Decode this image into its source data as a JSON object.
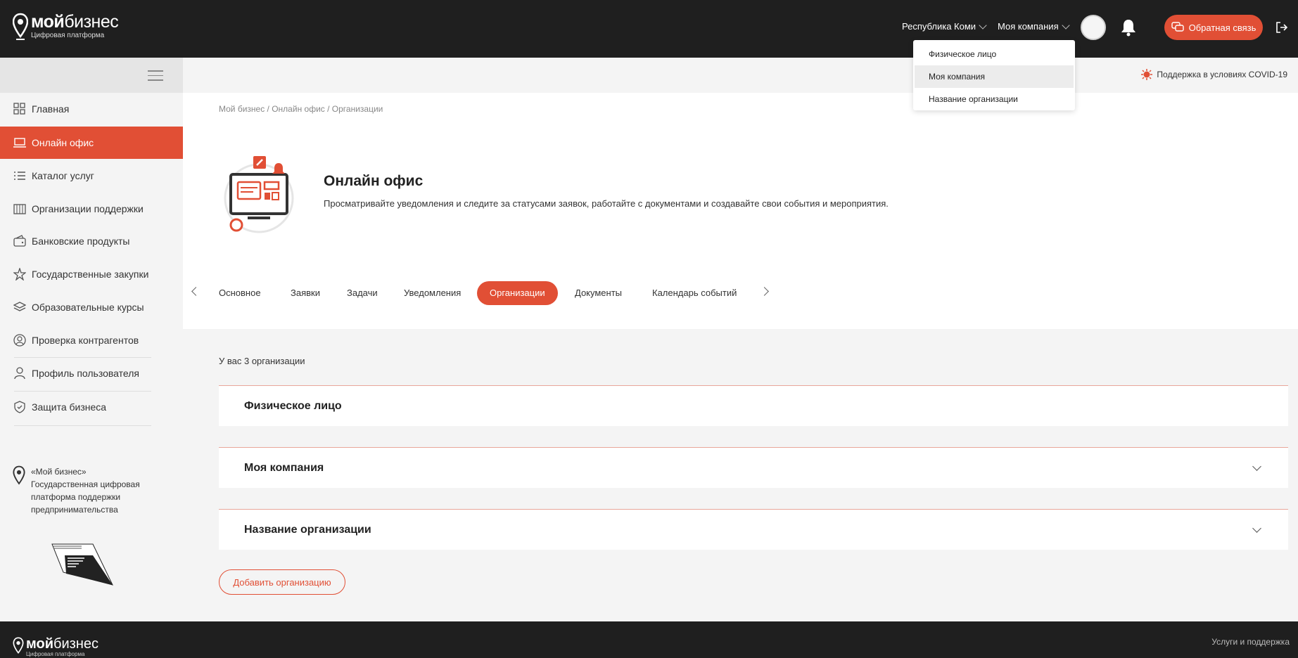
{
  "header": {
    "logo_bold": "мой",
    "logo_light": "бизнес",
    "logo_sub": "Цифровая платформа",
    "region": "Республика Коми",
    "company": "Моя компания",
    "feedback_label": "Обратная связь"
  },
  "company_dropdown": {
    "items": [
      "Физическое лицо",
      "Моя компания",
      "Название организации"
    ],
    "selected": "Моя компания"
  },
  "sidebar": {
    "items": [
      {
        "label": "Главная",
        "icon": "grid-icon"
      },
      {
        "label": "Онлайн офис",
        "icon": "laptop-icon",
        "active": true
      },
      {
        "label": "Каталог услуг",
        "icon": "list-icon"
      },
      {
        "label": "Организации поддержки",
        "icon": "building-icon"
      },
      {
        "label": "Банковские продукты",
        "icon": "wallet-icon"
      },
      {
        "label": "Государственные закупки",
        "icon": "star-icon"
      },
      {
        "label": "Образовательные курсы",
        "icon": "layers-icon"
      },
      {
        "label": "Проверка контрагентов",
        "icon": "check-person-icon"
      },
      {
        "label": "Профиль пользователя",
        "icon": "user-icon"
      },
      {
        "label": "Защита бизнеса",
        "icon": "shield-icon"
      }
    ],
    "about_lines": [
      "«Мой бизнес»",
      "Государственная цифровая",
      "платформа поддержки",
      "предпринимательства"
    ]
  },
  "main": {
    "covid": "Поддержка в условиях COVID-19",
    "breadcrumb": "Мой бизнес / Онлайн офис / Организации",
    "title": "Онлайн офис",
    "description": "Просматривайте уведомления и следите за статусами заявок, работайте с документами и создавайте свои события и мероприятия.",
    "tabs": [
      "Основное",
      "Заявки",
      "Задачи",
      "Уведомления",
      "Организации",
      "Документы",
      "Календарь событий"
    ],
    "active_tab": "Организации",
    "org_count": "У вас 3 организации",
    "orgs": [
      "Физическое лицо",
      "Моя компания",
      "Название организации"
    ],
    "add_button": "Добавить организацию"
  },
  "footer": {
    "logo_bold": "мой",
    "logo_light": "бизнес",
    "logo_sub": "Цифровая платформа",
    "link": "Услуги и поддержка"
  },
  "colors": {
    "accent": "#e14f35",
    "topbar": "#1f1f1f",
    "sidebar_bg": "#f4f4f4"
  }
}
